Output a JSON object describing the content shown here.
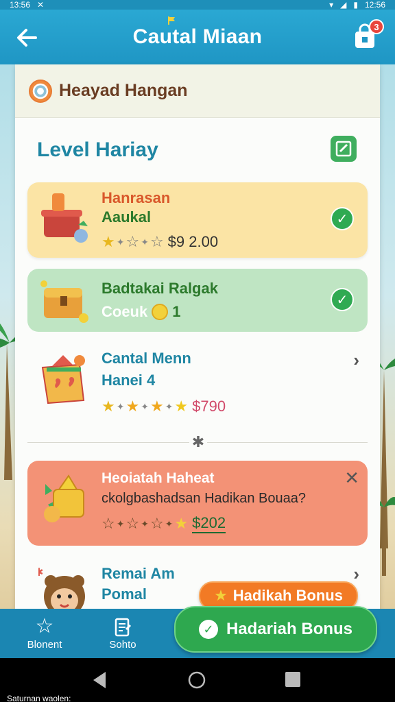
{
  "status_bar": {
    "time": "13:56",
    "right_time": "12:56"
  },
  "app_bar": {
    "title": "Cautal Miaan",
    "badge_count": "3"
  },
  "panel": {
    "header_label": "Heayad Hangan",
    "section_title": "Level Hariay"
  },
  "cards": [
    {
      "title": "Hanrasan",
      "subtitle": "Aaukal",
      "price": "$9 2.00",
      "title_color": "#d9582b",
      "subtitle_color": "#2c7a2c",
      "action": "check"
    },
    {
      "title": "Badtakai Ralgak",
      "subtitle": "Coeuk",
      "coins": "1",
      "title_color": "#2c7a2c",
      "subtitle_color": "#ffffff",
      "action": "check"
    },
    {
      "title": "Cantal Menn",
      "subtitle": "Hanei 4",
      "price": "$790",
      "title_color": "#1f86a3",
      "subtitle_color": "#1f86a3",
      "action": "chevron"
    },
    {
      "title": "Heoiatah Haheat",
      "subtitle": "ckolgbashadsan Hadikan Bouaa?",
      "price": "$202",
      "title_color": "#ffffff",
      "subtitle_color": "#2a2a2a",
      "action": "close"
    },
    {
      "title": "Remai Am",
      "subtitle": "Pomal",
      "title_color": "#1f86a3",
      "subtitle_color": "#1f86a3",
      "action": "chevron"
    }
  ],
  "bottom_nav": {
    "items": [
      {
        "label": "Blonent",
        "icon": "star-outline-icon"
      },
      {
        "label": "Sohto",
        "icon": "clipboard-icon"
      }
    ],
    "bonus_small_label": "Hadikah Bonus",
    "bonus_big_label": "Hadariah Bonus"
  },
  "colors": {
    "primary": "#1f96c4",
    "accent_green": "#2ea84f",
    "accent_orange": "#f27a25"
  },
  "footer_caption": "Saturnan waolen:"
}
